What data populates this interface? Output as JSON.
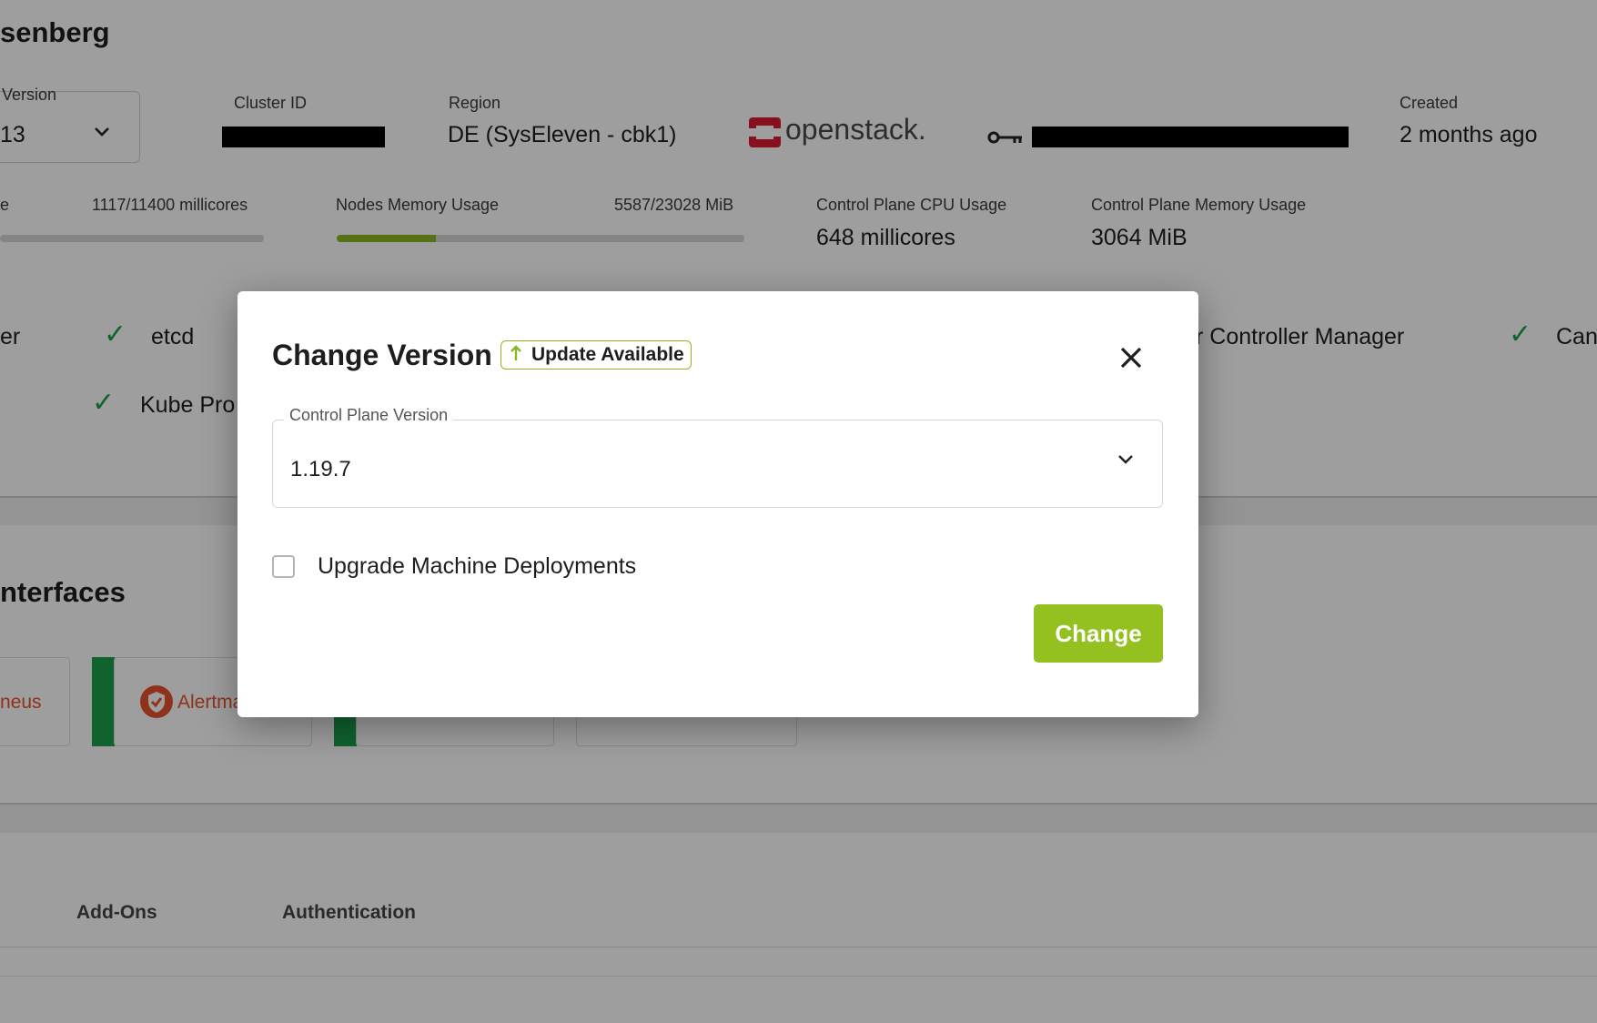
{
  "background": {
    "cluster_title": "senberg",
    "version": {
      "label": "Version",
      "value": "13"
    },
    "cluster_id": {
      "label": "Cluster ID"
    },
    "region": {
      "label": "Region",
      "value": "DE (SysEleven - cbk1)"
    },
    "provider_logo_text": "openstack.",
    "created": {
      "label": "Created",
      "value": "2 months ago"
    },
    "metrics": {
      "cpu": {
        "label_fragment": "e",
        "value": "1117/11400 millicores"
      },
      "memory": {
        "label": "Nodes Memory Usage",
        "value": "5587/23028 MiB",
        "fraction": 0.243
      },
      "cp_cpu": {
        "label": "Control Plane CPU Usage",
        "value": "648 millicores"
      },
      "cp_memory": {
        "label": "Control Plane Memory Usage",
        "value": "3064 MiB"
      }
    },
    "components": {
      "fragment_left": "er",
      "etcd": "etcd",
      "kube_proxy": "Kube Pro",
      "controller_manager": "r Controller Manager",
      "can": "Can"
    },
    "interfaces": {
      "heading": "nterfaces",
      "prometheus_fragment": "neus",
      "alertmanager_fragment": "Alertma"
    },
    "tabs": [
      "Add-Ons",
      "Authentication"
    ]
  },
  "dialog": {
    "title": "Change Version",
    "badge": "Update Available",
    "field_label": "Control Plane Version",
    "field_value": "1.19.7",
    "checkbox_label": "Upgrade Machine Deployments",
    "checkbox_checked": false,
    "submit_label": "Change"
  },
  "icons": {
    "badge_icon": "arrow-up-icon",
    "close_icon": "close-icon",
    "dropdown_icon": "chevron-down-icon",
    "key_icon": "key-icon",
    "status_icon": "check-icon",
    "alertmanager_icon": "shield-icon"
  },
  "colors": {
    "accent": "#94c120",
    "accent_border": "#8ab822",
    "success": "#1b9e4b",
    "openstack_red": "#da1a32",
    "alertmanager": "#e6522c"
  }
}
